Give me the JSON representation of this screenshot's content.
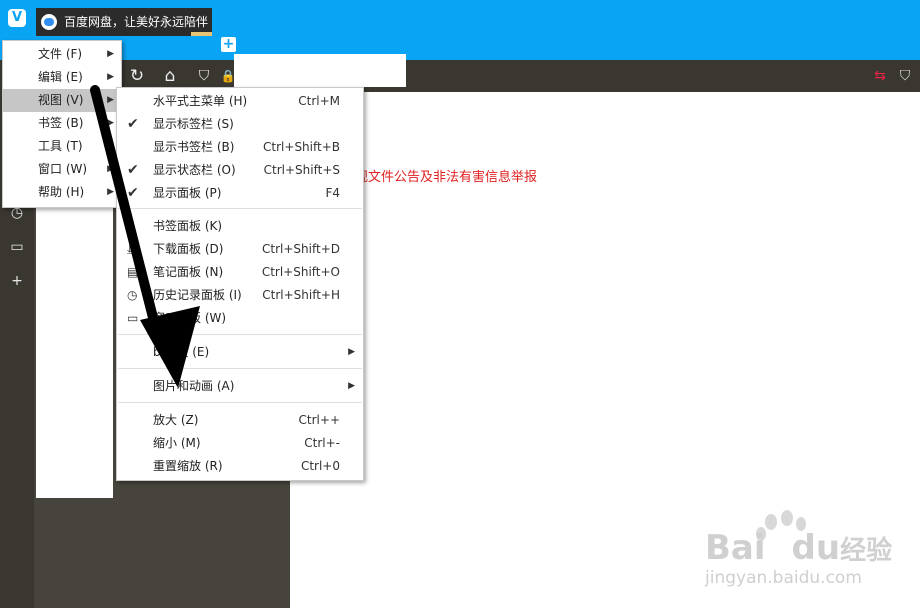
{
  "tab": {
    "title": "百度网盘，让美好永远陪伴"
  },
  "content": {
    "notice": "规文件公告及非法有害信息举报"
  },
  "main_menu": [
    {
      "label": "文件 (F)"
    },
    {
      "label": "编辑 (E)"
    },
    {
      "label": "视图 (V)",
      "highlighted": true
    },
    {
      "label": "书签 (B)"
    },
    {
      "label": "工具 (T)"
    },
    {
      "label": "窗口 (W)"
    },
    {
      "label": "帮助 (H)"
    }
  ],
  "view_submenu": {
    "group1": [
      {
        "label": "水平式主菜单 (H)",
        "shortcut": "Ctrl+M",
        "checked": false
      },
      {
        "label": "显示标签栏 (S)",
        "shortcut": "",
        "checked": true
      },
      {
        "label": "显示书签栏 (B)",
        "shortcut": "Ctrl+Shift+B",
        "checked": false
      },
      {
        "label": "显示状态栏 (O)",
        "shortcut": "Ctrl+Shift+S",
        "checked": true
      },
      {
        "label": "显示面板 (P)",
        "shortcut": "F4",
        "checked": true
      }
    ],
    "group2": [
      {
        "label": "书签面板 (K)",
        "shortcut": "",
        "icon": "bookmark-icon"
      },
      {
        "label": "下载面板 (D)",
        "shortcut": "Ctrl+Shift+D",
        "icon": "download-icon"
      },
      {
        "label": "笔记面板 (N)",
        "shortcut": "Ctrl+Shift+O",
        "icon": "notes-icon"
      },
      {
        "label": "历史记录面板 (I)",
        "shortcut": "Ctrl+Shift+H",
        "icon": "history-icon"
      },
      {
        "label": "窗口面板 (W)",
        "shortcut": "",
        "icon": "window-icon"
      }
    ],
    "group3": [
      {
        "label": "b 面板 (E)",
        "has_submenu": true
      }
    ],
    "group4": [
      {
        "label": "图片和动画 (A)",
        "has_submenu": true
      }
    ],
    "group5": [
      {
        "label": "放大 (Z)",
        "shortcut": "Ctrl++"
      },
      {
        "label": "缩小 (M)",
        "shortcut": "Ctrl+-"
      },
      {
        "label": "重置缩放 (R)",
        "shortcut": "Ctrl+0"
      }
    ]
  },
  "watermark": {
    "brand_left": "Bai",
    "brand_right": "du",
    "brand_cn": "经验",
    "url": "jingyan.baidu.com"
  },
  "colors": {
    "titlebar": "#0aa4f4",
    "toolbar": "#3a3731",
    "notice_red": "#e02020",
    "menu_highlight": "#c6c6c6"
  }
}
